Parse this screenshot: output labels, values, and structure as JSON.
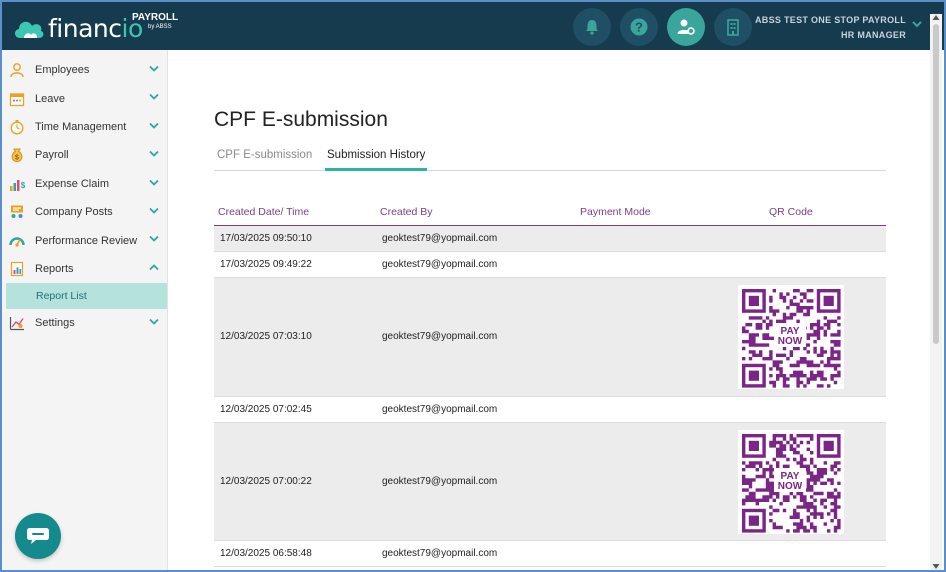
{
  "brand": {
    "name_main": "financ",
    "name_accent": "io",
    "product": "PAYROLL",
    "by": "by ABSS"
  },
  "header": {
    "org_name": "ABSS TEST ONE STOP PAYROLL",
    "role": "HR MANAGER",
    "accent": "#3aa59b"
  },
  "sidebar": {
    "items": [
      {
        "label": "Employees",
        "icon": "person-icon"
      },
      {
        "label": "Leave",
        "icon": "calendar-icon"
      },
      {
        "label": "Time Management",
        "icon": "stopwatch-icon"
      },
      {
        "label": "Payroll",
        "icon": "money-bag-icon"
      },
      {
        "label": "Expense Claim",
        "icon": "expense-chart-icon"
      },
      {
        "label": "Company Posts",
        "icon": "posts-icon"
      },
      {
        "label": "Performance Review",
        "icon": "gauge-icon"
      },
      {
        "label": "Reports",
        "icon": "report-icon"
      }
    ],
    "sub_item": "Report List",
    "settings": {
      "label": "Settings",
      "icon": "settings-chart-icon"
    }
  },
  "page": {
    "title": "CPF E-submission",
    "tabs": [
      "CPF E-submission",
      "Submission History"
    ],
    "active_tab": "Submission History"
  },
  "table": {
    "headers": [
      "Created Date/ Time",
      "Created By",
      "Payment Mode",
      "QR Code"
    ],
    "rows": [
      {
        "date": "17/03/2025 09:50:10",
        "by": "geoktest79@yopmail.com",
        "qr": false
      },
      {
        "date": "17/03/2025 09:49:22",
        "by": "geoktest79@yopmail.com",
        "qr": false
      },
      {
        "date": "12/03/2025 07:03:10",
        "by": "geoktest79@yopmail.com",
        "qr": true
      },
      {
        "date": "12/03/2025 07:02:45",
        "by": "geoktest79@yopmail.com",
        "qr": false
      },
      {
        "date": "12/03/2025 07:00:22",
        "by": "geoktest79@yopmail.com",
        "qr": true
      },
      {
        "date": "12/03/2025 06:58:48",
        "by": "geoktest79@yopmail.com",
        "qr": false
      }
    ]
  },
  "qr_label": {
    "line1": "PAY",
    "line2": "NOW",
    "color": "#7b2587"
  }
}
